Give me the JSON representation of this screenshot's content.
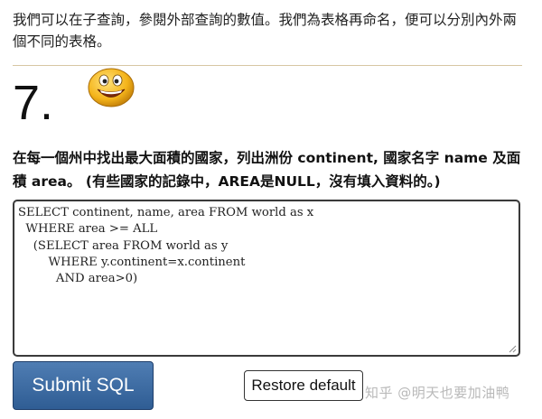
{
  "intro": {
    "text": "我們可以在子查詢，參閱外部查詢的數值。我們為表格再命名，便可以分別內外兩個不同的表格。"
  },
  "question": {
    "number": "7.",
    "icon": "smiley-face-icon",
    "text": "在每一個州中找出最大面積的國家，列出洲份 continent, 國家名字 name 及面積 area。 (有些國家的記錄中，AREA是NULL，沒有填入資料的。)"
  },
  "editor": {
    "sql": "SELECT continent, name, area FROM world as x\n  WHERE area >= ALL\n    (SELECT area FROM world as y\n        WHERE y.continent=x.continent\n          AND area>0)"
  },
  "buttons": {
    "submit_label": "Submit SQL",
    "restore_label": "Restore default"
  },
  "watermark": {
    "text": "知乎 @明天也要加油鸭"
  },
  "colors": {
    "submit_bg": "#3b6aa3",
    "divider": "#d7c7a3"
  }
}
